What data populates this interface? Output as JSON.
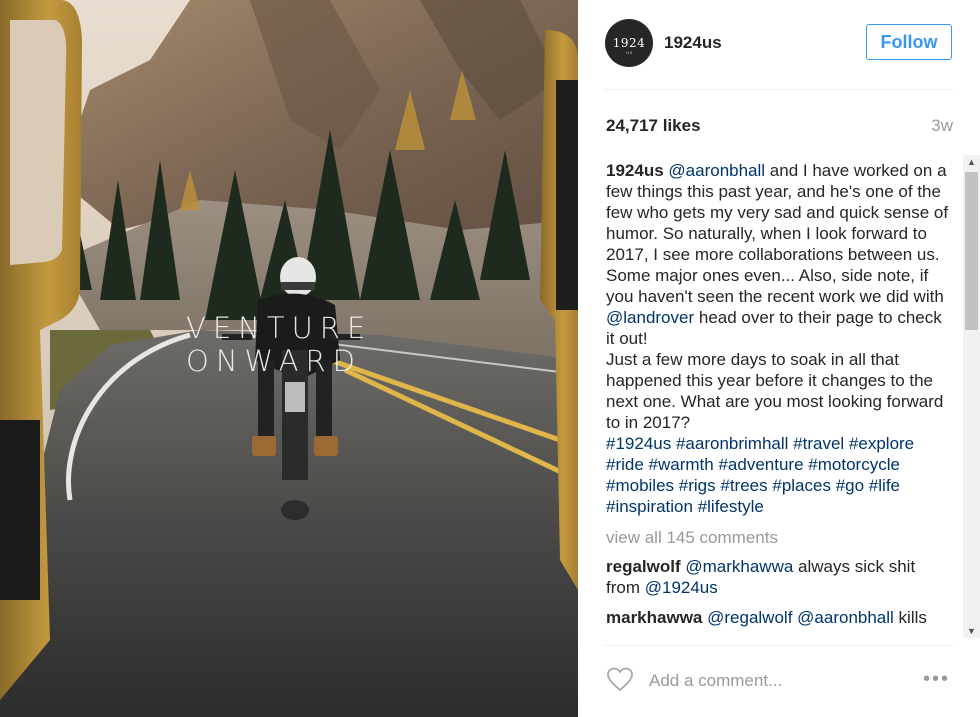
{
  "photo": {
    "overlay_line1": "VENTURE",
    "overlay_line2": "ONWARD"
  },
  "post": {
    "avatar_text": "1924",
    "avatar_sub": "us",
    "username": "1924us",
    "follow_label": "Follow",
    "likes": "24,717 likes",
    "time_ago": "3w"
  },
  "caption": {
    "user": "1924us",
    "mention1": "@aaronbhall",
    "text1": " and I have worked on a few things this past year, and he's one of the few who gets my very sad and quick sense of humor. So naturally, when I look forward to 2017, I see more collaborations between us. Some major ones even... Also, side note, if you haven't seen the recent work we did with ",
    "mention2": "@landrover",
    "text2": " head over to their page to check it out!",
    "text3": "Just a few more days to soak in all that happened this year before it changes to the next one. What are you most looking forward to in 2017?",
    "hashtags": [
      "#1924us",
      "#aaronbrimhall",
      "#travel",
      "#explore",
      "#ride",
      "#warmth",
      "#adventure",
      "#motorcycle",
      "#mobiles",
      "#rigs",
      "#trees",
      "#places",
      "#go",
      "#life",
      "#inspiration",
      "#lifestyle"
    ]
  },
  "view_all": "view all 145 comments",
  "comments": [
    {
      "user": "regalwolf",
      "mention": "@markhawwa",
      "text": " always sick shit from ",
      "mention2": "@1924us"
    },
    {
      "user": "markhawwa",
      "mention": "@regalwolf",
      "text": " ",
      "mention2": "@aaronbhall",
      "text2": " kills"
    }
  ],
  "footer": {
    "placeholder": "Add a comment...",
    "more": "•••"
  },
  "icons": {
    "heart": "heart-icon",
    "more": "more-options-icon",
    "scroll_up": "▲",
    "scroll_down": "▼"
  }
}
